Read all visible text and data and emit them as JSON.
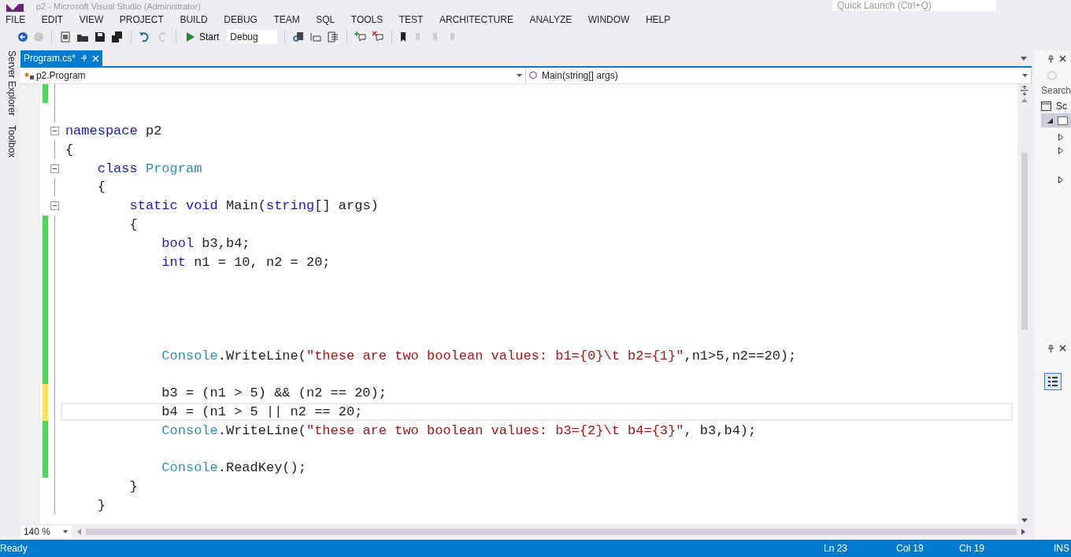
{
  "window": {
    "title": "p2 - Microsoft Visual Studio (Administrator)"
  },
  "quick_launch": {
    "placeholder": "Quick Launch (Ctrl+Q)"
  },
  "menu": [
    "FILE",
    "EDIT",
    "VIEW",
    "PROJECT",
    "BUILD",
    "DEBUG",
    "TEAM",
    "SQL",
    "TOOLS",
    "TEST",
    "ARCHITECTURE",
    "ANALYZE",
    "WINDOW",
    "HELP"
  ],
  "toolbar": {
    "start": "Start",
    "configuration": "Debug"
  },
  "side_tabs": [
    "Server Explorer",
    "Toolbox"
  ],
  "doc_tabs": [
    {
      "label": "Program.cs*",
      "selected": true
    }
  ],
  "nav_bar": {
    "type": "p2.Program",
    "member": "Main(string[] args)"
  },
  "code": [
    {
      "modified": true,
      "saved": true,
      "current": false
    },
    {
      "modified": false,
      "current": false
    },
    {
      "modified": false,
      "current": false,
      "collapsible": true,
      "segments": [
        {
          "kind": "keyword",
          "text": "namespace"
        },
        {
          "kind": "plain",
          "text": " p2"
        }
      ]
    },
    {
      "modified": false,
      "current": false,
      "segments": [
        {
          "kind": "plain",
          "text": "{"
        }
      ]
    },
    {
      "modified": false,
      "current": false,
      "collapsible": true,
      "segments": [
        {
          "kind": "keyword",
          "text": "    class"
        },
        {
          "kind": "type",
          "text": " Program"
        }
      ]
    },
    {
      "modified": false,
      "current": false,
      "segments": [
        {
          "kind": "plain",
          "text": "    {"
        }
      ]
    },
    {
      "modified": false,
      "current": false,
      "collapsible": true,
      "segments": [
        {
          "kind": "keyword",
          "text": "        static"
        },
        {
          "kind": "keyword",
          "text": " void"
        },
        {
          "kind": "plain",
          "text": " Main("
        },
        {
          "kind": "keyword",
          "text": "string"
        },
        {
          "kind": "plain",
          "text": "[] args)"
        }
      ]
    },
    {
      "modified": true,
      "saved": true,
      "current": false,
      "segments": [
        {
          "kind": "plain",
          "text": "        {"
        }
      ]
    },
    {
      "modified": true,
      "saved": true,
      "current": false,
      "segments": [
        {
          "kind": "keyword",
          "text": "            bool"
        },
        {
          "kind": "plain",
          "text": " b3,b4;"
        }
      ]
    },
    {
      "modified": true,
      "saved": true,
      "current": false,
      "segments": [
        {
          "kind": "keyword",
          "text": "            int"
        },
        {
          "kind": "plain",
          "text": " n1 = 10, n2 = 20;"
        }
      ]
    },
    {
      "modified": true,
      "saved": true,
      "current": false
    },
    {
      "modified": true,
      "saved": true,
      "current": false
    },
    {
      "modified": true,
      "saved": true,
      "current": false
    },
    {
      "modified": true,
      "saved": true,
      "current": false
    },
    {
      "modified": true,
      "saved": true,
      "current": false,
      "segments": [
        {
          "kind": "type",
          "text": "            Console"
        },
        {
          "kind": "plain",
          "text": ".WriteLine("
        },
        {
          "kind": "string",
          "text": "\"these are two boolean values: b1={0}\\t b2={1}\""
        },
        {
          "kind": "plain",
          "text": ",n1>5,n2==20);"
        }
      ]
    },
    {
      "modified": true,
      "saved": true,
      "current": false
    },
    {
      "modified": true,
      "saved": false,
      "current": false,
      "segments": [
        {
          "kind": "plain",
          "text": "            b3 = (n1 > 5) && (n2 == 20);"
        }
      ]
    },
    {
      "modified": true,
      "saved": false,
      "current": true,
      "segments": [
        {
          "kind": "plain",
          "text": "            b4 = (n1 > 5 || n2 == 20;"
        }
      ]
    },
    {
      "modified": true,
      "saved": true,
      "current": false,
      "segments": [
        {
          "kind": "type",
          "text": "            Console"
        },
        {
          "kind": "plain",
          "text": ".WriteLine("
        },
        {
          "kind": "string",
          "text": "\"these are two boolean values: b3={2}\\t b4={3}\""
        },
        {
          "kind": "plain",
          "text": ", b3,b4);"
        }
      ]
    },
    {
      "modified": true,
      "saved": true,
      "current": false
    },
    {
      "modified": true,
      "saved": true,
      "current": false,
      "segments": [
        {
          "kind": "type",
          "text": "            Console"
        },
        {
          "kind": "plain",
          "text": ".ReadKey();"
        }
      ]
    },
    {
      "modified": false,
      "current": false,
      "segments": [
        {
          "kind": "plain",
          "text": "        }"
        }
      ]
    },
    {
      "modified": false,
      "current": false,
      "segments": [
        {
          "kind": "plain",
          "text": "    }"
        }
      ]
    }
  ],
  "zoom": "140 %",
  "side_panel": {
    "search": "Search",
    "item": "Sc"
  },
  "status_bar": {
    "message": "Ready",
    "line": "Ln 23",
    "column": "Col 19",
    "char": "Ch 19",
    "mode": "INS"
  }
}
